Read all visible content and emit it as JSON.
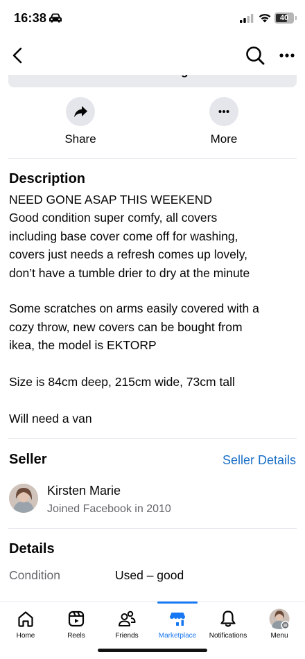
{
  "status_bar": {
    "time": "16:38",
    "battery_level": "40"
  },
  "listing": {
    "boost_label": "Boost listing",
    "actions": [
      {
        "label": "Share",
        "icon": "share-arrow-icon"
      },
      {
        "label": "More",
        "icon": "ellipsis-icon"
      }
    ]
  },
  "description": {
    "title": "Description",
    "lines": [
      "NEED GONE ASAP THIS WEEKEND",
      "Good condition super comfy, all covers",
      "including base cover come off for washing,",
      "covers just needs a refresh comes up lovely,",
      "don’t have a tumble drier to dry at the minute",
      "Some scratches on arms easily covered with a",
      "cozy throw, new covers can be bought from",
      "ikea, the model is EKTORP",
      "Size is 84cm deep, 215cm wide, 73cm tall",
      "Will need a van"
    ]
  },
  "seller": {
    "title": "Seller",
    "details_link": "Seller Details",
    "name": "Kirsten Marie",
    "joined": "Joined Facebook in 2010"
  },
  "details": {
    "title": "Details",
    "condition_label": "Condition",
    "condition_value": "Used – good"
  },
  "tab_bar": {
    "tabs": [
      {
        "label": "Home",
        "icon": "home-icon"
      },
      {
        "label": "Reels",
        "icon": "reels-icon"
      },
      {
        "label": "Friends",
        "icon": "friends-icon"
      },
      {
        "label": "Marketplace",
        "icon": "marketplace-icon",
        "active": true
      },
      {
        "label": "Notifications",
        "icon": "bell-icon"
      },
      {
        "label": "Menu",
        "icon": "profile-avatar-icon"
      }
    ]
  },
  "colors": {
    "accent": "#1877f2",
    "link": "#1a6fc7",
    "secondary_text": "#65676b",
    "button_bg": "#e4e6eb"
  }
}
